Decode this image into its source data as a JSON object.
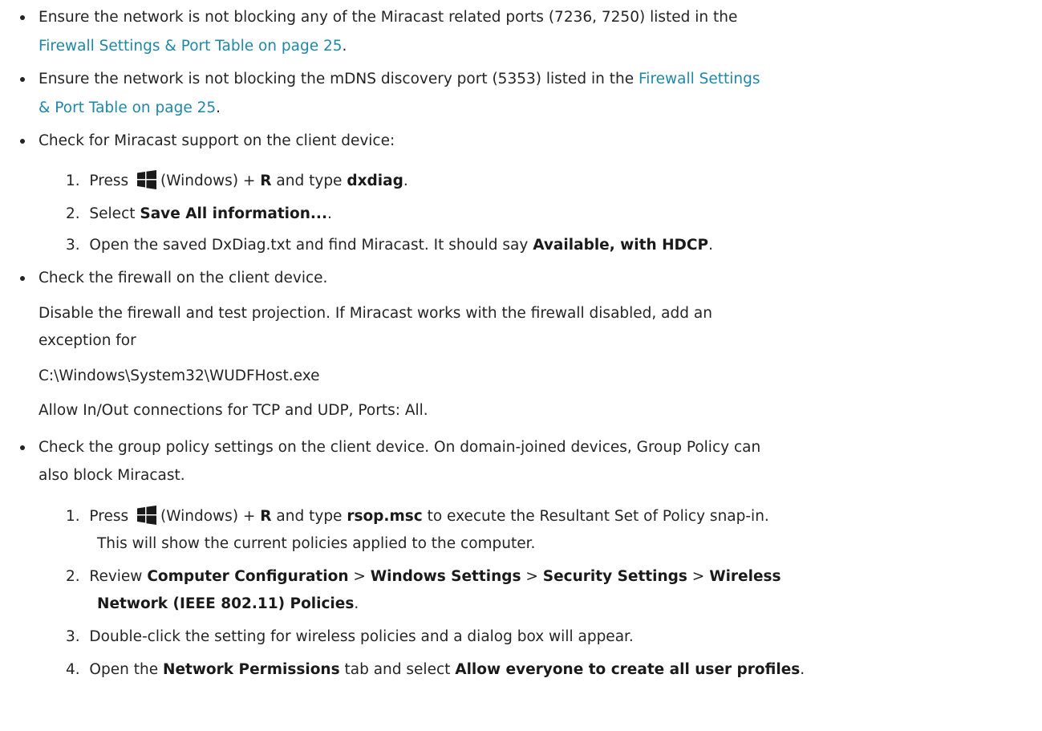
{
  "b1": {
    "l1": "Ensure the network is not blocking any of the Miracast related ports (7236, 7250) listed in the",
    "link": "Firewall Settings & Port Table on page 25",
    "end": "."
  },
  "b2": {
    "l1": "Ensure the network is not blocking the mDNS discovery port (5353) listed in the ",
    "link_a": "Firewall Settings",
    "link_b": "& Port Table on page 25",
    "end": "."
  },
  "b3": {
    "text": "Check for Miracast support on the client device:",
    "s1": {
      "num": "1.",
      "press": "Press",
      "win": "(Windows) + ",
      "key": "R",
      "mid": " and type ",
      "cmd": "dxdiag",
      "end": "."
    },
    "s2": {
      "num": "2.",
      "pre": "Select ",
      "bold": "Save All information...",
      "end": "."
    },
    "s3": {
      "num": "3.",
      "pre": "Open the saved DxDiag.txt and find Miracast. It should say ",
      "bold": "Available, with HDCP",
      "end": "."
    }
  },
  "b4": {
    "text": "Check the firewall on the client device.",
    "p1a": "Disable the firewall and test projection. If Miracast works with the firewall disabled, add an",
    "p1b": "exception for",
    "path": "C:\\Windows\\System32\\WUDFHost.exe",
    "p2": "Allow In/Out connections for TCP and UDP, Ports: All."
  },
  "b5": {
    "l1": "Check the group policy settings on the client device. On domain-joined devices, Group Policy can",
    "l2": "also block Miracast.",
    "s1": {
      "num": "1.",
      "press": "Press",
      "win": "(Windows) + ",
      "key": "R",
      "mid": " and type ",
      "cmd": "rsop.msc",
      "rest": " to execute the Resultant Set of Policy snap-in.",
      "l2": "This will show the current policies applied to the computer."
    },
    "s2": {
      "num": "2.",
      "pre": "Review ",
      "c1": "Computer Configuration",
      "sep1": " > ",
      "c2": "Windows Settings",
      "sep2": " > ",
      "c3": "Security Settings",
      "sep3": " > ",
      "c4": "Wireless",
      "c5": "Network (IEEE 802.11) Policies",
      "end": "."
    },
    "s3": {
      "num": "3.",
      "text": "Double-click the setting for wireless policies and a dialog box will appear."
    },
    "s4": {
      "num": "4.",
      "pre": "Open the ",
      "b1": "Network Permissions",
      "mid": " tab and select ",
      "b2": "Allow everyone to create all user profiles",
      "end": "."
    }
  },
  "colors": {
    "link": "#1f87a8",
    "text": "#242424",
    "windows_logo": "#1a1a1a"
  },
  "icons": [
    "windows-logo-icon"
  ]
}
